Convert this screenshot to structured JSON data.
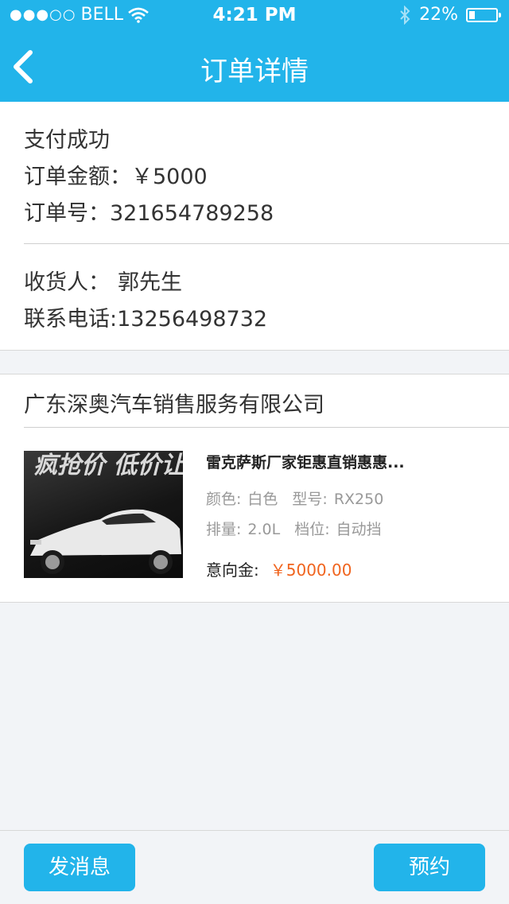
{
  "status_bar": {
    "signal": "●●●○○",
    "carrier": "BELL",
    "time": "4:21 PM",
    "battery_percent": "22%",
    "battery_level": 0.22
  },
  "nav": {
    "title": "订单详情"
  },
  "order": {
    "status": "支付成功",
    "amount_label": "订单金额：",
    "amount": "￥5000",
    "number_label": "订单号：",
    "number": "321654789258"
  },
  "consignee": {
    "name_label": "收货人：",
    "name": "郭先生",
    "phone_label": "联系电话:",
    "phone": "13256498732"
  },
  "shop": {
    "name": "广东深奥汽车销售服务有限公司"
  },
  "product": {
    "title": "雷克萨斯厂家钜惠直销惠惠...",
    "image_text": "疯抢价 低价让利",
    "color_label": "颜色:",
    "color": "白色",
    "model_label": "型号:",
    "model": "RX250",
    "displacement_label": "排量:",
    "displacement": "2.0L",
    "gear_label": "档位:",
    "gear": "自动挡",
    "deposit_label": "意向金:",
    "deposit": "￥5000.00"
  },
  "actions": {
    "message": "发消息",
    "book": "预约"
  },
  "colors": {
    "primary": "#22b4ea",
    "price": "#f0641e",
    "background": "#f2f4f7"
  }
}
